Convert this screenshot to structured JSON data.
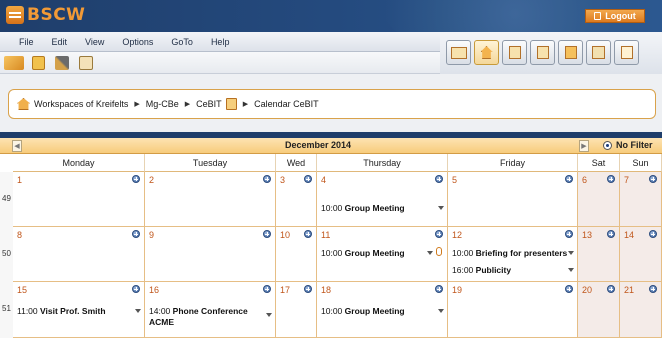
{
  "brand": {
    "logo_text": "BSCW",
    "logout_label": "Logout"
  },
  "menu": [
    "File",
    "Edit",
    "View",
    "Options",
    "GoTo",
    "Help"
  ],
  "breadcrumb": [
    "Workspaces of Kreifelts",
    "Mg-CBe",
    "CeBIT",
    "Calendar CeBIT"
  ],
  "calendar": {
    "month_title": "December 2014",
    "filter_label": "No Filter",
    "days": [
      "Monday",
      "Tuesday",
      "Wed",
      "Thursday",
      "Friday",
      "Sat",
      "Sun"
    ],
    "weeks": [
      {
        "week": "49",
        "dates": [
          "1",
          "2",
          "3",
          "4",
          "5",
          "6",
          "7"
        ]
      },
      {
        "week": "50",
        "dates": [
          "8",
          "9",
          "10",
          "11",
          "12",
          "13",
          "14"
        ]
      },
      {
        "week": "51",
        "dates": [
          "15",
          "16",
          "17",
          "18",
          "19",
          "20",
          "21"
        ]
      }
    ],
    "events": {
      "w49_thu": {
        "time": "10:00",
        "title": "Group Meeting"
      },
      "w50_thu": {
        "time": "10:00",
        "title": "Group Meeting"
      },
      "w50_fri_1": {
        "time": "10:00",
        "title": "Briefing for presenters"
      },
      "w50_fri_2": {
        "time": "16:00",
        "title": "Publicity"
      },
      "w51_mon": {
        "time": "11:00",
        "title": "Visit Prof. Smith"
      },
      "w51_tue_a": {
        "time": "14:00",
        "title": "Phone Conference"
      },
      "w51_tue_b": {
        "time": "",
        "title": "ACME"
      },
      "w51_thu": {
        "time": "10:00",
        "title": "Group Meeting"
      }
    }
  },
  "colors": {
    "accent": "#f29a36",
    "header_blue": "#1f3e6b",
    "date_orange": "#c0561b"
  }
}
